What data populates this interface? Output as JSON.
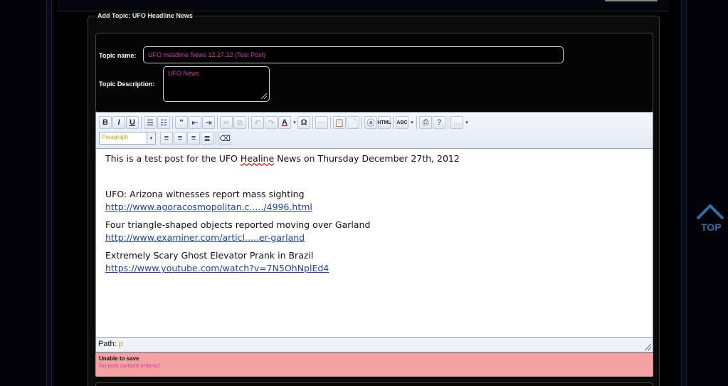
{
  "legend": "Add Topic: UFO Headline News",
  "form": {
    "topic_name_label": "Topic name:",
    "topic_name_value": "UFO Headline News 12.27.12 (Test Post)",
    "topic_description_label": "Topic Description:",
    "topic_description_value": "UFO News"
  },
  "toolbar": {
    "bold": "B",
    "italic": "I",
    "underline": "U",
    "quote": "“",
    "text_color": "A",
    "omega": "Ω",
    "html": "HTML",
    "spell": "ABC",
    "format_value": "Paragraph"
  },
  "content": {
    "intro": "This is a test post for the UFO Healine News on Thursday December 27th, 2012",
    "items": [
      {
        "title": "UFO: Arizona witnesses report mass sighting",
        "link": "http://www.agoracosmopolitan.c...../4996.html"
      },
      {
        "title": "Four triangle-shaped objects reported moving over Garland",
        "link": "http://www.examiner.com/articl.....er-garland"
      },
      {
        "title": "Extremely Scary Ghost Elevator Prank in Brazil",
        "link": "https://www.youtube.com/watch?v=7N5OhNplEd4"
      }
    ]
  },
  "path": {
    "label": "Path:",
    "value": "p"
  },
  "error": {
    "title": "Unable to save",
    "message": "No post content entered"
  },
  "top_link": {
    "label": "TOP",
    "icon": "chevron-up-icon"
  },
  "colors": {
    "accent_pink": "#d03ea8",
    "link_blue": "#1f3fb5",
    "error_bg": "#f4a1a1",
    "top_blue": "#2e6fa8"
  }
}
